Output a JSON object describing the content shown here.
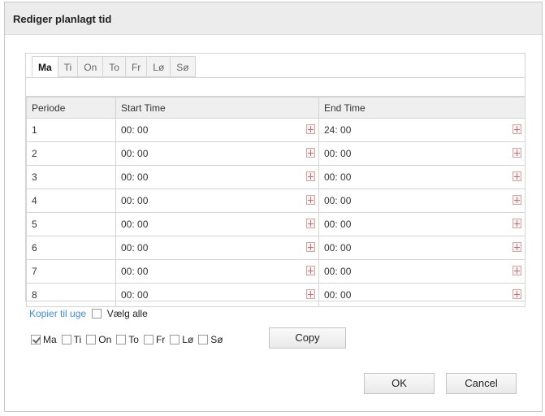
{
  "dialog": {
    "title": "Rediger planlagt tid"
  },
  "tabs": [
    {
      "label": "Ma",
      "active": true
    },
    {
      "label": "Ti",
      "active": false
    },
    {
      "label": "On",
      "active": false
    },
    {
      "label": "To",
      "active": false
    },
    {
      "label": "Fr",
      "active": false
    },
    {
      "label": "Lø",
      "active": false
    },
    {
      "label": "Sø",
      "active": false
    }
  ],
  "table": {
    "headers": [
      "Periode",
      "Start Time",
      "End Time"
    ],
    "rows": [
      {
        "period": "1",
        "start": "00: 00",
        "end": "24: 00"
      },
      {
        "period": "2",
        "start": "00: 00",
        "end": "00: 00"
      },
      {
        "period": "3",
        "start": "00: 00",
        "end": "00: 00"
      },
      {
        "period": "4",
        "start": "00: 00",
        "end": "00: 00"
      },
      {
        "period": "5",
        "start": "00: 00",
        "end": "00: 00"
      },
      {
        "period": "6",
        "start": "00: 00",
        "end": "00: 00"
      },
      {
        "period": "7",
        "start": "00: 00",
        "end": "00: 00"
      },
      {
        "period": "8",
        "start": "00: 00",
        "end": "00: 00"
      }
    ]
  },
  "copy": {
    "link_label": "Kopier til uge",
    "select_all_label": "Vælg alle",
    "days": [
      {
        "label": "Ma",
        "checked": true
      },
      {
        "label": "Ti",
        "checked": false
      },
      {
        "label": "On",
        "checked": false
      },
      {
        "label": "To",
        "checked": false
      },
      {
        "label": "Fr",
        "checked": false
      },
      {
        "label": "Lø",
        "checked": false
      },
      {
        "label": "Sø",
        "checked": false
      }
    ],
    "copy_button": "Copy"
  },
  "buttons": {
    "ok": "OK",
    "cancel": "Cancel"
  },
  "icons": {
    "time_picker": "time-picker-icon"
  }
}
